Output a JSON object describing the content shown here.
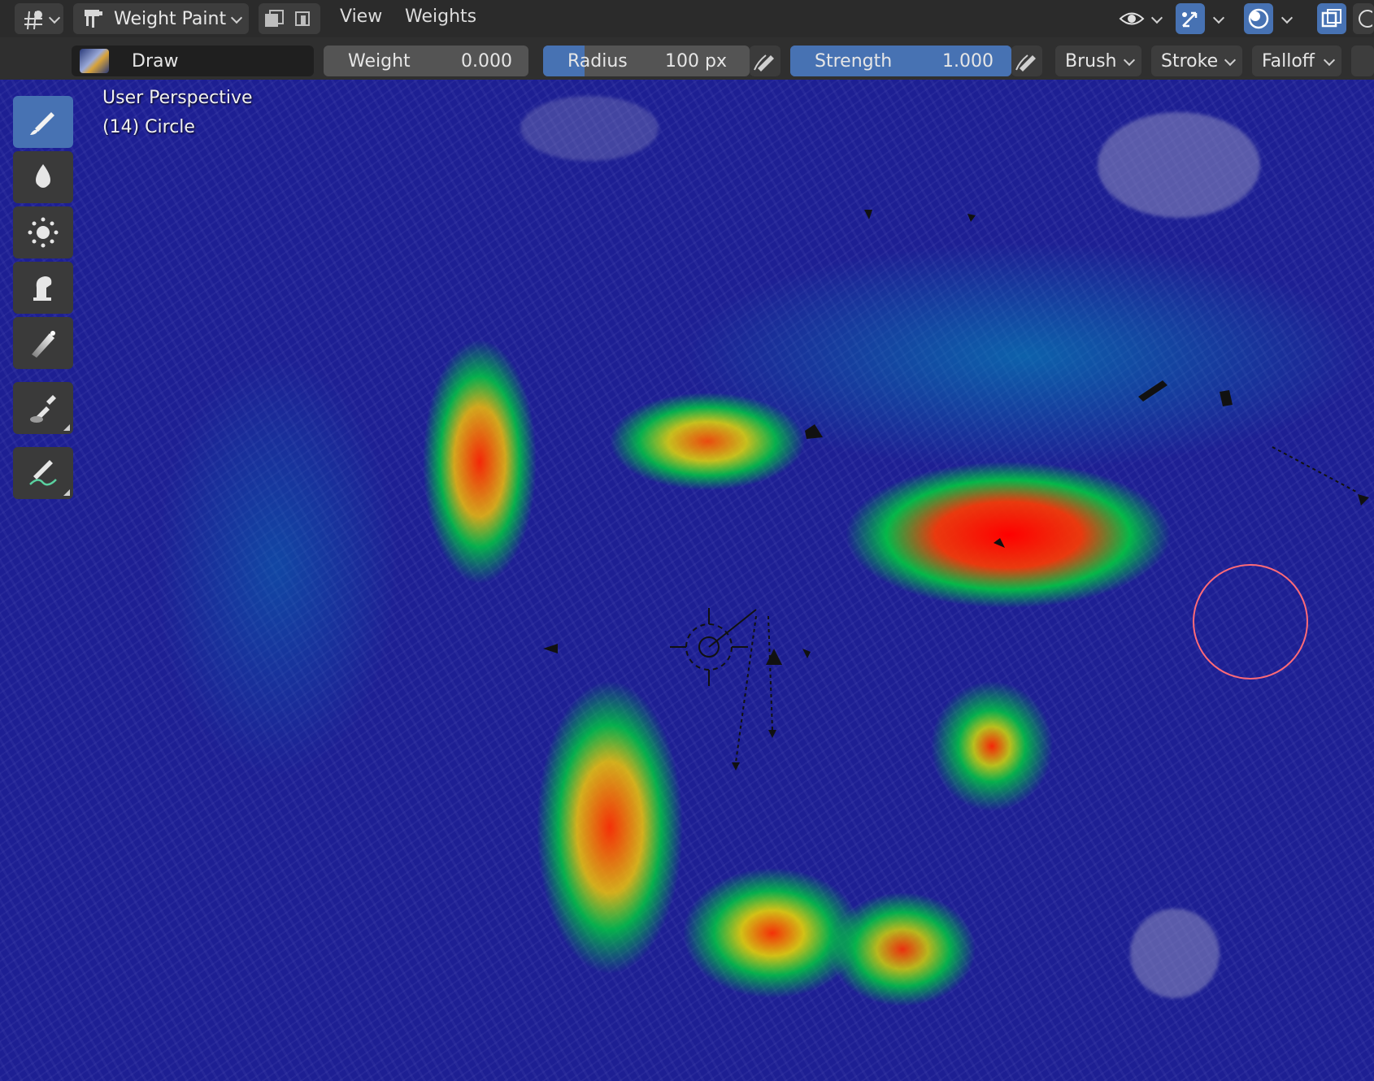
{
  "header": {
    "mode_label": "Weight Paint",
    "menus": [
      "View",
      "Weights"
    ]
  },
  "tool_settings": {
    "brush_name": "Draw",
    "weight": {
      "label": "Weight",
      "value": "0.000"
    },
    "radius": {
      "label": "Radius",
      "value": "100 px",
      "fill_fraction": 0.2
    },
    "strength": {
      "label": "Strength",
      "value": "1.000",
      "fill_fraction": 1.0
    },
    "dropdowns": [
      "Brush",
      "Stroke",
      "Falloff"
    ]
  },
  "viewport": {
    "view_name": "User Perspective",
    "object_info": "(14) Circle"
  },
  "toolbar": {
    "tools": [
      "brush-draw-icon",
      "drop-blur-icon",
      "average-icon",
      "smear-icon",
      "gradient-icon",
      "eyedropper-icon",
      "annotate-icon"
    ],
    "active_tool": "brush-draw-icon"
  },
  "colors": {
    "accent": "#4772b3",
    "header_bg": "#2b2b2b",
    "weight_zero": "#1d1f93",
    "weight_full": "#ff0000",
    "brush_cursor": "#ff6a78"
  }
}
